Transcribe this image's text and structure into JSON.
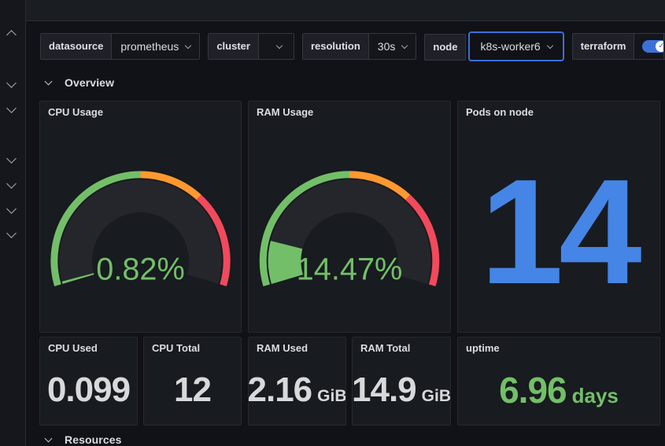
{
  "colors": {
    "page_bg": "#111217",
    "panel_bg": "#181B1F",
    "green": "#73BF69",
    "orange": "#FF9830",
    "red": "#F2495C",
    "blue": "#4585E6",
    "accent_blue": "#3D71D9",
    "text_primary": "#D8D9DA"
  },
  "sidebar": {
    "chevrons": [
      "up",
      "down",
      "down",
      "down",
      "down",
      "down",
      "down"
    ]
  },
  "toolbar": {
    "variables": [
      {
        "label": "datasource",
        "value": "prometheus"
      },
      {
        "label": "cluster",
        "value": ""
      },
      {
        "label": "resolution",
        "value": "30s"
      },
      {
        "label": "node",
        "value": "k8s-worker6",
        "focused": true
      }
    ],
    "toggle": {
      "label": "terraform",
      "on": true,
      "check": "✓"
    }
  },
  "rows": [
    {
      "label": "Overview",
      "collapsed": false
    },
    {
      "label": "Resources",
      "collapsed": false
    }
  ],
  "panels": {
    "gauges": [
      {
        "title": "CPU Usage",
        "percent": 0.82,
        "display": "0.82%",
        "color": "#73BF69",
        "min": 0,
        "max": 100,
        "thresholds": [
          {
            "pct": 0,
            "color": "#73BF69"
          },
          {
            "pct": 50,
            "color": "#FF9830"
          },
          {
            "pct": 70,
            "color": "#F2495C"
          }
        ]
      },
      {
        "title": "RAM Usage",
        "percent": 14.47,
        "display": "14.47%",
        "color": "#73BF69",
        "min": 0,
        "max": 100,
        "thresholds": [
          {
            "pct": 0,
            "color": "#73BF69"
          },
          {
            "pct": 50,
            "color": "#FF9830"
          },
          {
            "pct": 70,
            "color": "#F2495C"
          }
        ]
      }
    ],
    "pods": {
      "title": "Pods on node",
      "value": "14",
      "color": "#4585E6"
    },
    "stats": [
      {
        "title": "CPU Used",
        "value": "0.099",
        "suffix": "",
        "color": "#D8D9DA"
      },
      {
        "title": "CPU Total",
        "value": "12",
        "suffix": "",
        "color": "#D8D9DA"
      },
      {
        "title": "RAM Used",
        "value": "2.16",
        "suffix": "GiB",
        "color": "#D8D9DA"
      },
      {
        "title": "RAM Total",
        "value": "14.9",
        "suffix": "GiB",
        "color": "#D8D9DA"
      },
      {
        "title": "uptime",
        "value": "6.96",
        "suffix": "days",
        "color": "#73BF69"
      }
    ]
  }
}
